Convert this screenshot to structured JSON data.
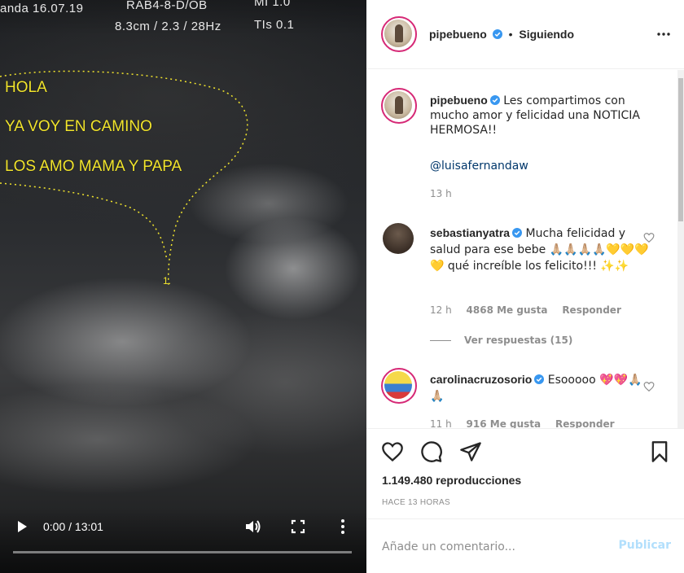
{
  "video": {
    "scanner_top_left": "anda  16.07.19",
    "scanner_top_mid": "RAB4-8-D/OB",
    "scanner_top_right": "MI 1.0",
    "scanner_second_mid": "8.3cm / 2.3 / 28Hz",
    "scanner_second_right": "TIs 0.1",
    "overlay_lines": [
      "HOLA",
      "YA VOY EN CAMINO",
      "LOS AMO MAMA Y PAPA"
    ],
    "time": "0:00 / 13:01",
    "progress": 0
  },
  "header": {
    "username": "pipebueno",
    "separator": "•",
    "follow_status": "Siguiendo"
  },
  "caption": {
    "username": "pipebueno",
    "text": "Les compartimos con mucho amor y felicidad una NOTICIA HERMOSA!!",
    "mention": "@luisafernandaw",
    "time": "13 h"
  },
  "comments": [
    {
      "username": "sebastianyatra",
      "text": "Mucha felicidad y salud para ese bebe 🙏🏼🙏🏼🙏🏼🙏🏼💛💛💛💛 qué increíble los felicito!!! ✨✨",
      "time": "12 h",
      "likes": "4868 Me gusta",
      "reply": "Responder",
      "replies": "Ver respuestas (15)"
    },
    {
      "username": "carolinacruzosorio",
      "text": "Esooooo 💖💖🙏🏼🙏🏼",
      "time": "11 h",
      "likes": "916 Me gusta",
      "reply": "Responder"
    }
  ],
  "actions": {
    "views": "1.149.480 reproducciones",
    "posted": "HACE 13 HORAS"
  },
  "add_comment": {
    "placeholder": "Añade un comentario...",
    "publish": "Publicar"
  },
  "colors": {
    "verified": "#3897f0",
    "link": "#00376b",
    "muted": "#8e8e8e",
    "publish_disabled": "#b2dffc",
    "overlay_text": "#f2e52d"
  }
}
